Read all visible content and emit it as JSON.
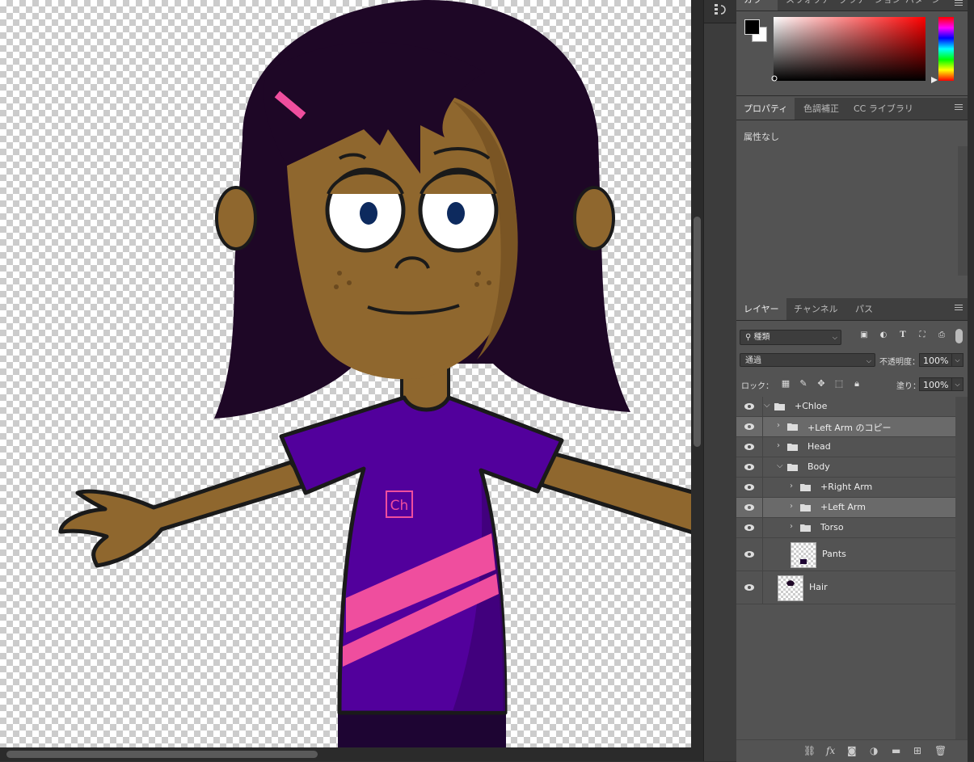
{
  "color_panel": {
    "tabs": [
      "カラー",
      "スウォッチ",
      "グラデーション",
      "パターン"
    ],
    "foreground": "#000000",
    "background": "#ffffff"
  },
  "properties_panel": {
    "tabs": [
      "プロパティ",
      "色調補正",
      "CC ライブラリ"
    ],
    "empty_text": "属性なし"
  },
  "layers_panel": {
    "tabs": [
      "レイヤー",
      "チャンネル",
      "パス"
    ],
    "filter_kind": "種類",
    "blend_mode": "通過",
    "opacity_label": "不透明度：",
    "opacity_value": "100%",
    "lock_label": "ロック：",
    "fill_label": "塗り：",
    "fill_value": "100%",
    "layers": [
      {
        "name": "+Chloe",
        "type": "group",
        "depth": 0,
        "expanded": true,
        "selected": false
      },
      {
        "name": "+Left Arm のコピー",
        "type": "group",
        "depth": 1,
        "expanded": false,
        "selected": true
      },
      {
        "name": "Head",
        "type": "group",
        "depth": 1,
        "expanded": false,
        "selected": false
      },
      {
        "name": "Body",
        "type": "group",
        "depth": 1,
        "expanded": true,
        "selected": false
      },
      {
        "name": "+Right Arm",
        "type": "group",
        "depth": 2,
        "expanded": false,
        "selected": false
      },
      {
        "name": "+Left Arm",
        "type": "group",
        "depth": 2,
        "expanded": false,
        "selected": true
      },
      {
        "name": "Torso",
        "type": "group",
        "depth": 2,
        "expanded": false,
        "selected": false
      },
      {
        "name": "Pants",
        "type": "layer",
        "depth": 2,
        "selected": false
      },
      {
        "name": "Hair",
        "type": "layer",
        "depth": 1,
        "selected": false
      }
    ]
  },
  "canvas": {
    "shirt_logo": "Ch",
    "colors": {
      "hair": "#1e0726",
      "skin": "#8f672e",
      "shirt": "#52009c",
      "stripe": "#ef4e9e",
      "pants": "#1e0533",
      "outline": "#1a1a1a"
    }
  }
}
